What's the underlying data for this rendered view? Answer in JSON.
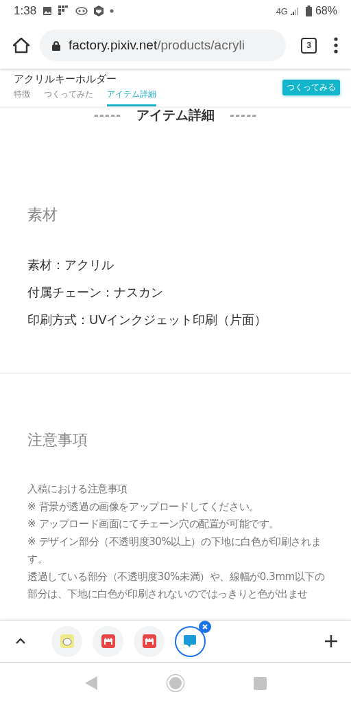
{
  "status_bar": {
    "time": "1:38",
    "network": "4G",
    "battery": "68%"
  },
  "browser": {
    "url_host": "factory.pixiv.net",
    "url_path": "/products/acryli",
    "tab_count": "3"
  },
  "page_header": {
    "title": "アクリルキーホルダー",
    "tabs": [
      {
        "label": "特徴",
        "selected": false
      },
      {
        "label": "つくってみた",
        "selected": false
      },
      {
        "label": "アイテム詳細",
        "selected": true
      }
    ],
    "cta": "つくってみる"
  },
  "section_title": {
    "dashes_left": "-----",
    "text": "アイテム詳細",
    "dashes_right": "-----"
  },
  "material": {
    "heading": "素材",
    "items": [
      "素材：アクリル",
      "付属チェーン：ナスカン",
      "印刷方式：UVインクジェット印刷（片面）"
    ]
  },
  "notes": {
    "heading": "注意事項",
    "lines": [
      "入稿における注意事項",
      "※ 背景が透過の画像をアップロードしてください。",
      "※ アップロード画面にてチェーン穴の配置が可能です。",
      "※ デザイン部分（不透明度30%以上）の下地に白色が印刷されます。",
      "透過している部分（不透明度30%未満）や、線幅が0.3mm以下の部分は、下地に白色が印刷されないのではっきりと色が出ませ"
    ]
  },
  "tab_strip": {
    "tabs": [
      {
        "selected": false
      },
      {
        "selected": false
      },
      {
        "selected": false
      },
      {
        "selected": true
      }
    ]
  }
}
